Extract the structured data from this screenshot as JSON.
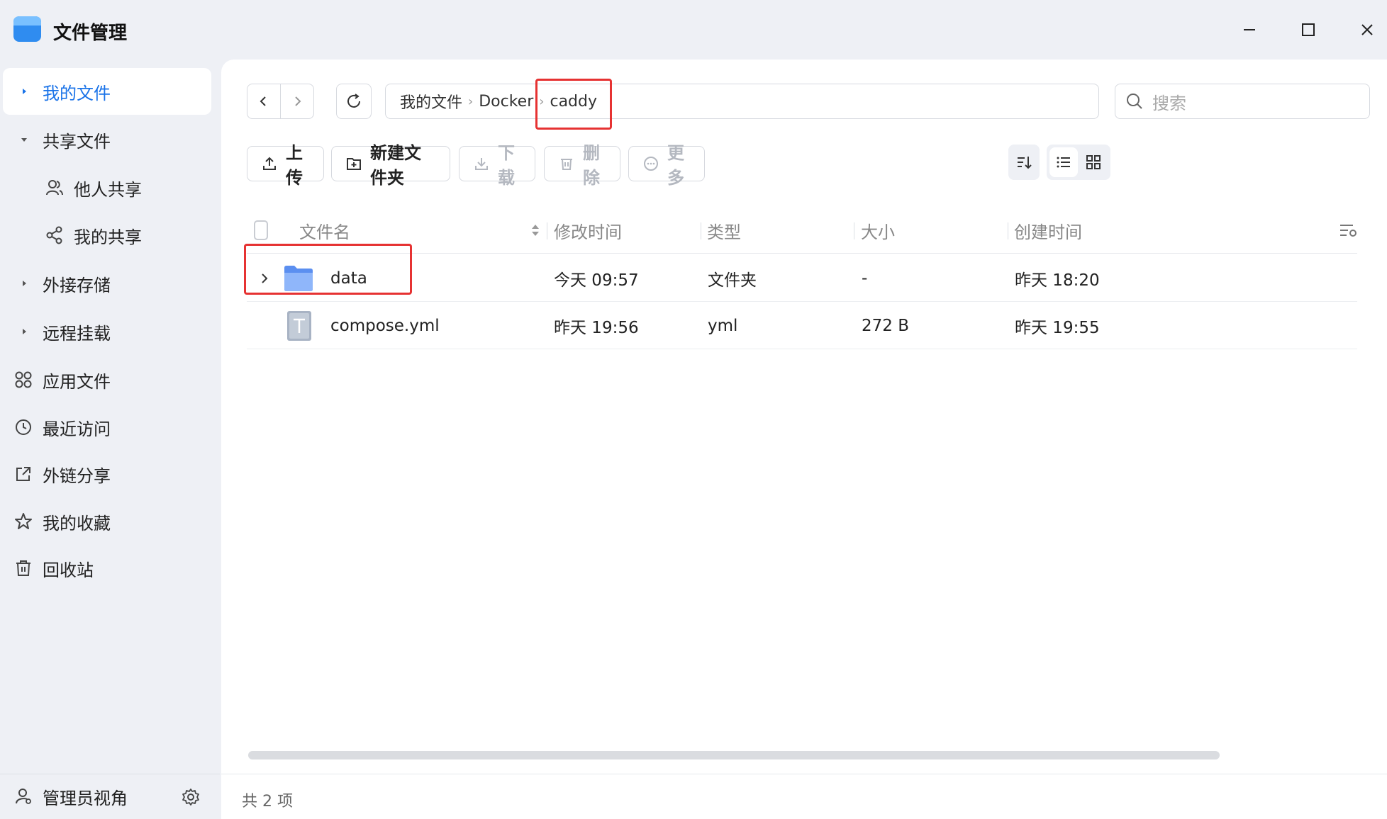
{
  "window": {
    "title": "文件管理",
    "controls": [
      "minimize",
      "maximize",
      "close"
    ]
  },
  "sidebar": {
    "items": [
      {
        "label": "我的文件",
        "icon": "caret-right-icon",
        "active": true
      },
      {
        "label": "共享文件",
        "icon": "caret-down-icon"
      },
      {
        "label": "他人共享",
        "icon": "users-icon",
        "sub": true
      },
      {
        "label": "我的共享",
        "icon": "share-icon",
        "sub": true
      },
      {
        "label": "外接存储",
        "icon": "caret-right-icon"
      },
      {
        "label": "远程挂载",
        "icon": "caret-right-icon"
      },
      {
        "label": "应用文件",
        "icon": "apps-grid-icon"
      },
      {
        "label": "最近访问",
        "icon": "clock-icon"
      },
      {
        "label": "外链分享",
        "icon": "external-link-icon"
      },
      {
        "label": "我的收藏",
        "icon": "star-icon"
      },
      {
        "label": "回收站",
        "icon": "trash-icon"
      }
    ],
    "admin_label": "管理员视角"
  },
  "breadcrumb": [
    "我的文件",
    "Docker",
    "caddy"
  ],
  "search": {
    "placeholder": "搜索"
  },
  "toolbar": {
    "upload": "上传",
    "new_folder": "新建文件夹",
    "download": "下载",
    "delete": "删除",
    "more": "更多"
  },
  "table": {
    "headers": {
      "name": "文件名",
      "modified": "修改时间",
      "type": "类型",
      "size": "大小",
      "created": "创建时间"
    },
    "rows": [
      {
        "name": "data",
        "modified": "今天 09:57",
        "type": "文件夹",
        "size": "-",
        "created": "昨天 18:20",
        "kind": "folder"
      },
      {
        "name": "compose.yml",
        "modified": "昨天 19:56",
        "type": "yml",
        "size": "272 B",
        "created": "昨天 19:55",
        "kind": "text-file"
      }
    ]
  },
  "status": {
    "count_text": "共 2 项"
  },
  "colors": {
    "accent": "#1a73e8",
    "highlight": "#e63232",
    "folder": "#7aa7f5"
  }
}
